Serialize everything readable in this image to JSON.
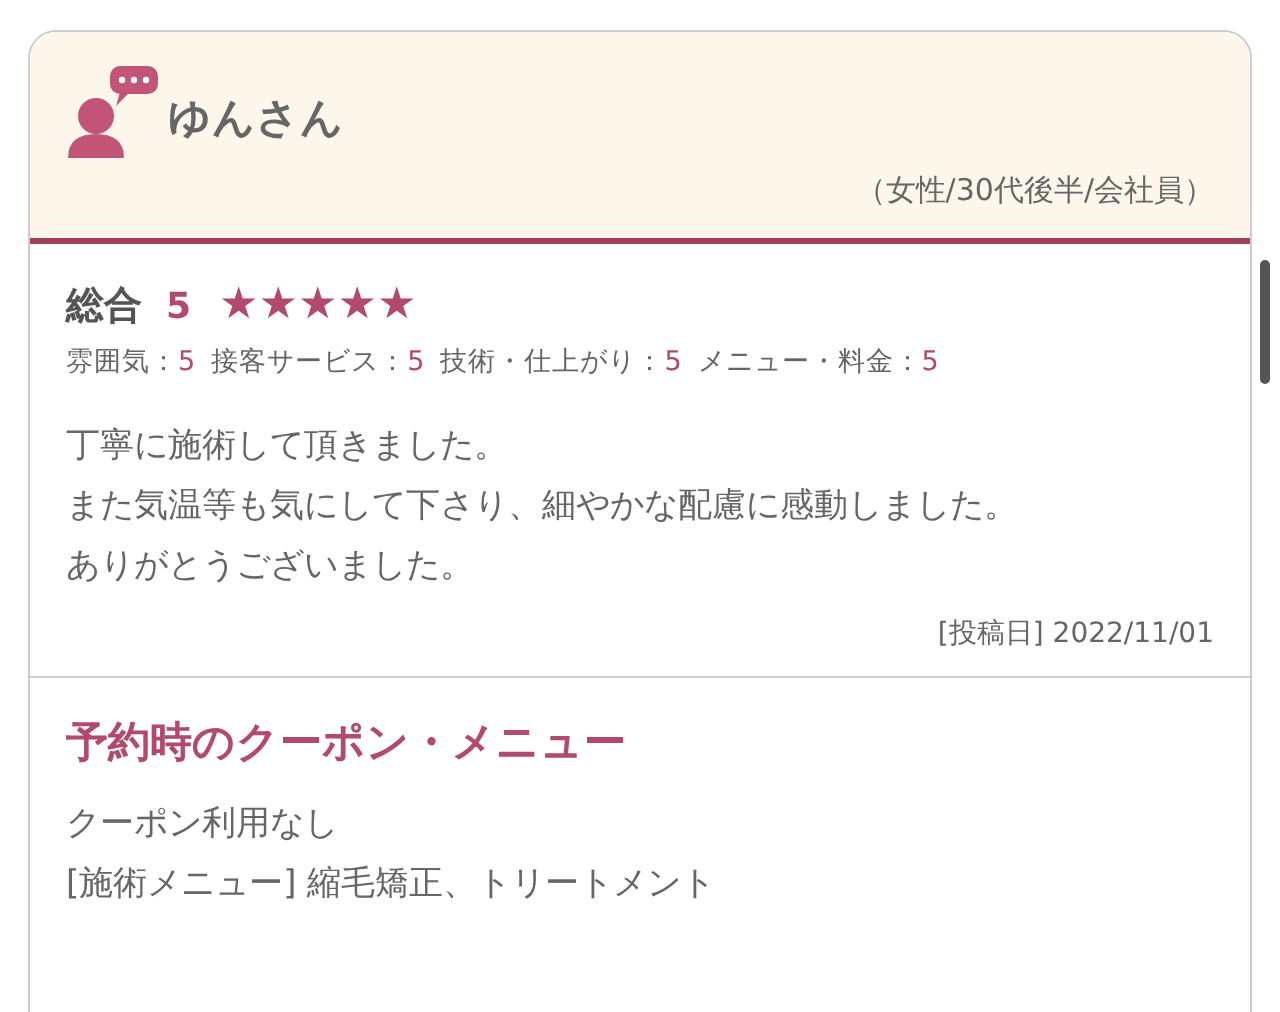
{
  "reviewer": {
    "name": "ゆんさん",
    "details": "（女性/30代後半/会社員）"
  },
  "overall": {
    "label": "総合",
    "score": "5",
    "stars": 5
  },
  "sub_ratings": [
    {
      "label": "雰囲気：",
      "value": "5"
    },
    {
      "label": "接客サービス：",
      "value": "5"
    },
    {
      "label": "技術・仕上がり：",
      "value": "5"
    },
    {
      "label": "メニュー・料金：",
      "value": "5"
    }
  ],
  "comment": [
    "丁寧に施術して頂きました。",
    "また気温等も気にして下さり、細やかな配慮に感動しました。",
    "ありがとうございました。"
  ],
  "posted": "[投稿日] 2022/11/01",
  "coupon": {
    "title": "予約時のクーポン・メニュー",
    "lines": [
      "クーポン利用なし",
      "[施術メニュー] 縮毛矯正、トリートメント"
    ]
  }
}
